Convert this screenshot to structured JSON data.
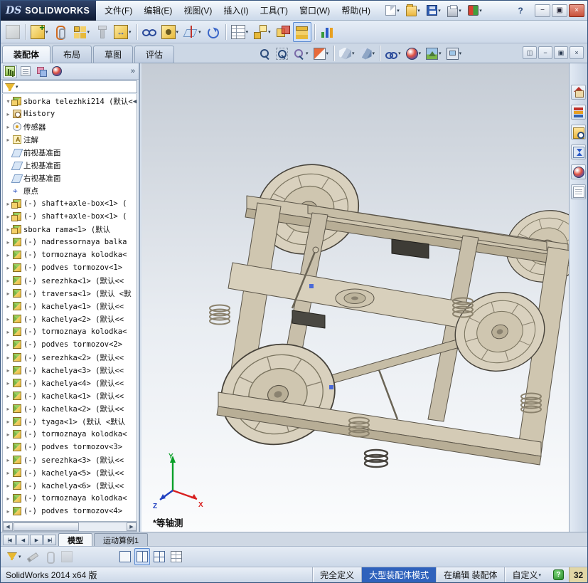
{
  "glyphs": {
    "caret": "▾",
    "expander": "▸",
    "expanded": "▾",
    "left": "◀",
    "right": "▶"
  },
  "titlebar": {
    "logo": "DS",
    "brand": "SOLIDWORKS",
    "menus": [
      {
        "key": "file",
        "label": "文件(F)"
      },
      {
        "key": "edit",
        "label": "编辑(E)"
      },
      {
        "key": "view",
        "label": "视图(V)"
      },
      {
        "key": "insert",
        "label": "插入(I)"
      },
      {
        "key": "tools",
        "label": "工具(T)"
      },
      {
        "key": "window",
        "label": "窗口(W)"
      },
      {
        "key": "help",
        "label": "帮助(H)"
      }
    ],
    "quick_tools": [
      {
        "name": "new-document-button",
        "icon": "new-doc",
        "caret": true
      },
      {
        "name": "open-document-button",
        "icon": "open-doc",
        "caret": true
      },
      {
        "name": "save-button",
        "icon": "save",
        "caret": true
      },
      {
        "name": "print-button",
        "icon": "print",
        "caret": true
      },
      {
        "name": "options-button",
        "icon": "options",
        "caret": true
      }
    ],
    "help_label": "?",
    "window_buttons": [
      {
        "key": "min",
        "name": "minimize-button",
        "glyph": "−"
      },
      {
        "key": "restore",
        "name": "restore-button",
        "glyph": "▣"
      },
      {
        "key": "close",
        "name": "close-button",
        "glyph": "×"
      }
    ]
  },
  "command_toolbar": [
    {
      "name": "edit-component-button",
      "icon": "edit-component",
      "grayed": true
    },
    {
      "sep": true
    },
    {
      "name": "insert-components-button",
      "icon": "insert-component",
      "caret": true
    },
    {
      "name": "mate-button",
      "icon": "mate"
    },
    {
      "name": "linear-component-pattern-button",
      "icon": "component-pattern",
      "caret": true
    },
    {
      "name": "smart-fasteners-button",
      "icon": "smart-fasteners",
      "grayed": true
    },
    {
      "name": "move-component-button",
      "icon": "move-component",
      "caret": true
    },
    {
      "sep": true
    },
    {
      "name": "show-hidden-components-button",
      "icon": "show-hidden"
    },
    {
      "name": "assembly-features-button",
      "icon": "assembly-features",
      "caret": true
    },
    {
      "name": "reference-geometry-button",
      "icon": "reference-geometry",
      "caret": true
    },
    {
      "name": "new-motion-study-button",
      "icon": "motion-study"
    },
    {
      "sep": true
    },
    {
      "name": "bill-of-materials-button",
      "icon": "bom-table",
      "caret": true
    },
    {
      "name": "exploded-view-button",
      "icon": "exploded-view",
      "caret": true
    },
    {
      "name": "interference-detection-button",
      "icon": "interference"
    },
    {
      "name": "large-assembly-mode-button",
      "icon": "large-assembly",
      "pressed": true
    },
    {
      "sep": true
    },
    {
      "name": "assembly-visualization-button",
      "icon": "visualization"
    }
  ],
  "command_tabs": [
    {
      "key": "assembly",
      "label": "装配体",
      "active": true
    },
    {
      "key": "layout",
      "label": "布局",
      "active": false
    },
    {
      "key": "sketch",
      "label": "草图",
      "active": false
    },
    {
      "key": "evaluate",
      "label": "评估",
      "active": false
    }
  ],
  "headsup_toolbar": [
    {
      "name": "zoom-to-fit-button",
      "icon": "zoom-fit"
    },
    {
      "name": "zoom-to-area-button",
      "icon": "zoom-area"
    },
    {
      "name": "previous-view-button",
      "icon": "previous-view",
      "caret": true
    },
    {
      "name": "section-view-button",
      "icon": "section-view",
      "caret": true
    },
    {
      "sep": true
    },
    {
      "name": "view-orientation-button",
      "icon": "view-orientation",
      "caret": true
    },
    {
      "name": "display-style-button",
      "icon": "display-style",
      "caret": true
    },
    {
      "sep": true
    },
    {
      "name": "hide-show-items-button",
      "icon": "hide-show",
      "caret": true
    },
    {
      "name": "edit-appearance-button",
      "icon": "appearance",
      "caret": true
    },
    {
      "name": "apply-scene-button",
      "icon": "scene",
      "caret": true
    },
    {
      "name": "view-settings-button",
      "icon": "view-settings",
      "caret": true
    }
  ],
  "pane_controls": [
    {
      "name": "split-pane-button",
      "glyph": "◫"
    },
    {
      "name": "document-minimize-button",
      "glyph": "−"
    },
    {
      "name": "document-restore-button",
      "glyph": "▣"
    },
    {
      "name": "document-close-button",
      "glyph": "×"
    }
  ],
  "feature_panel": {
    "header_tabs": [
      {
        "name": "featuremanager-tab",
        "icon": "fm-tree",
        "active": true
      },
      {
        "name": "propertymanager-tab",
        "icon": "fm-property"
      },
      {
        "name": "configurationmanager-tab",
        "icon": "fm-config"
      },
      {
        "name": "displaymanager-tab",
        "icon": "fm-display"
      }
    ],
    "overflow_label": "»",
    "filter": {
      "value": ""
    },
    "collapse_arrow": "◀",
    "root": {
      "label": "sborka telezhki214 (默认<",
      "icon": "assembly"
    },
    "items": [
      {
        "label": "History",
        "icon": "history",
        "exp": true
      },
      {
        "label": "传感器",
        "icon": "sensors",
        "exp": true
      },
      {
        "label": "注解",
        "icon": "annotations",
        "exp": true
      },
      {
        "label": "前视基准面",
        "icon": "plane"
      },
      {
        "label": "上视基准面",
        "icon": "plane"
      },
      {
        "label": "右视基准面",
        "icon": "plane"
      },
      {
        "label": "原点",
        "icon": "origin"
      },
      {
        "label": "(-) shaft+axle-box<1> (",
        "icon": "assembly",
        "exp": true
      },
      {
        "label": "(-) shaft+axle-box<1> (",
        "icon": "assembly",
        "exp": true
      },
      {
        "label": "sborka rama<1> (默认",
        "icon": "assembly",
        "exp": true
      },
      {
        "label": "(-) nadressornaya balka",
        "icon": "part",
        "exp": true
      },
      {
        "label": "(-) tormoznaya kolodka<",
        "icon": "part",
        "exp": true
      },
      {
        "label": "(-) podves tormozov<1>",
        "icon": "part",
        "exp": true
      },
      {
        "label": "(-) serezhka<1> (默认<<",
        "icon": "part",
        "exp": true
      },
      {
        "label": "(-) traversa<1> (默认 <默",
        "icon": "part",
        "exp": true
      },
      {
        "label": "(-) kachelya<1> (默认<<",
        "icon": "part",
        "exp": true
      },
      {
        "label": "(-) kachelya<2> (默认<<",
        "icon": "part",
        "exp": true
      },
      {
        "label": "(-) tormoznaya kolodka<",
        "icon": "part",
        "exp": true
      },
      {
        "label": "(-) podves tormozov<2>",
        "icon": "part",
        "exp": true
      },
      {
        "label": "(-) serezhka<2> (默认<<",
        "icon": "part",
        "exp": true
      },
      {
        "label": "(-) kachelya<3> (默认<<",
        "icon": "part",
        "exp": true
      },
      {
        "label": "(-) kachelya<4> (默认<<",
        "icon": "part",
        "exp": true
      },
      {
        "label": "(-) kachelka<1> (默认<<",
        "icon": "part",
        "exp": true
      },
      {
        "label": "(-) kachelka<2> (默认<<",
        "icon": "part",
        "exp": true
      },
      {
        "label": "(-) tyaga<1> (默认 <默认",
        "icon": "part",
        "exp": true
      },
      {
        "label": "(-) tormoznaya kolodka<",
        "icon": "part",
        "exp": true
      },
      {
        "label": "(-) podves tormozov<3>",
        "icon": "part",
        "exp": true
      },
      {
        "label": "(-) serezhka<3> (默认<<",
        "icon": "part",
        "exp": true
      },
      {
        "label": "(-) kachelya<5> (默认<<",
        "icon": "part",
        "exp": true
      },
      {
        "label": "(-) kachelya<6> (默认<<",
        "icon": "part",
        "exp": true
      },
      {
        "label": "(-) tormoznaya kolodka<",
        "icon": "part",
        "exp": true
      },
      {
        "label": "(-) podves tormozov<4>",
        "icon": "part",
        "exp": true
      }
    ]
  },
  "viewport": {
    "view_label": "*等轴测",
    "triad": {
      "x": "X",
      "y": "Y",
      "z": "Z"
    }
  },
  "task_pane": [
    {
      "name": "solidworks-resources-button",
      "icon": "home"
    },
    {
      "name": "design-library-button",
      "icon": "design-library"
    },
    {
      "name": "file-explorer-button",
      "icon": "file-explorer"
    },
    {
      "name": "view-palette-button",
      "icon": "view-palette"
    },
    {
      "name": "appearances-scenes-button",
      "icon": "appearances"
    },
    {
      "name": "custom-properties-button",
      "icon": "custom-properties"
    }
  ],
  "bottom_tabs": {
    "nav": [
      {
        "name": "first-tab-button",
        "glyph": "|◀"
      },
      {
        "name": "prev-tab-button",
        "glyph": "◀"
      },
      {
        "name": "next-tab-button",
        "glyph": "▶"
      },
      {
        "name": "last-tab-button",
        "glyph": "▶|"
      }
    ],
    "tabs": [
      {
        "label": "模型",
        "active": true
      },
      {
        "label": "运动算例1",
        "active": false
      }
    ]
  },
  "bottom_toolbar": [
    {
      "name": "selection-filter-button",
      "icon": "funnel",
      "caret": true
    },
    {
      "name": "edit-sketch-button",
      "icon": "pencil",
      "grayed": true
    },
    {
      "name": "attachments-button",
      "icon": "clip",
      "grayed": true
    },
    {
      "name": "inactive-tool-button",
      "icon": "blank",
      "grayed": true
    },
    {
      "name": "single-view-button",
      "icon": "viewport-single",
      "gap": 58
    },
    {
      "name": "two-view-button",
      "icon": "viewport-two",
      "pressed": true
    },
    {
      "name": "four-view-button",
      "icon": "viewport-four"
    },
    {
      "name": "link-views-button",
      "icon": "viewport-grid"
    }
  ],
  "status_bar": {
    "app_version": "SolidWorks 2014 x64 版",
    "segments": [
      {
        "name": "status-fully-defined",
        "label": "完全定义"
      },
      {
        "name": "status-large-assembly-mode",
        "label": "大型装配体模式",
        "highlight": true
      },
      {
        "name": "status-editing",
        "label": "在编辑 装配体"
      },
      {
        "name": "status-custom",
        "label": "自定义",
        "caret": true
      }
    ],
    "help_badge": "?",
    "overlay_badge": "32"
  }
}
